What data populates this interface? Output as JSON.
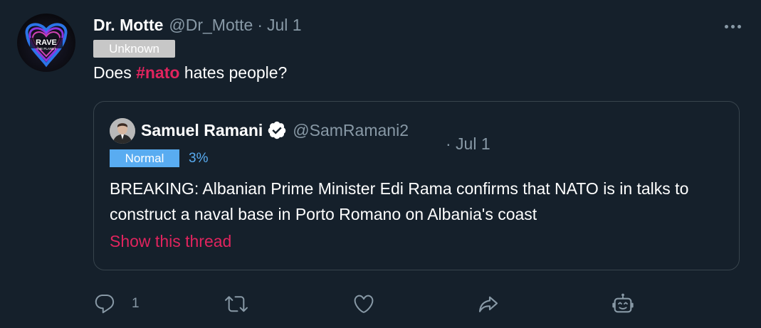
{
  "tweet": {
    "display_name": "Dr. Motte",
    "handle": "@Dr_Motte",
    "separator": "·",
    "date": "Jul 1",
    "label": "Unknown",
    "avatar_text_line1": "RAVE",
    "avatar_text_line2": "THE PLANET",
    "text_before": "Does ",
    "hashtag": "#nato",
    "text_after": " hates people?"
  },
  "quote": {
    "display_name": "Samuel Ramani",
    "handle": "@SamRamani2",
    "date": "· Jul 1",
    "label": "Normal",
    "score": "3%",
    "text": "BREAKING: Albanian Prime Minister Edi Rama confirms that NATO is in talks to construct a naval base in Porto Romano on Albania's coast",
    "show_thread": "Show this thread"
  },
  "actions": {
    "reply_count": "1"
  },
  "icons": {
    "more": "more-icon",
    "verified": "verified-badge-icon",
    "reply": "reply-icon",
    "retweet": "retweet-icon",
    "like": "heart-icon",
    "share": "share-icon",
    "bot": "robot-icon"
  },
  "colors": {
    "background": "#15202b",
    "secondary_text": "#8899a6",
    "hashtag": "#e0245e",
    "label_unknown": "#c7c7c7",
    "label_normal": "#59acf1",
    "border": "#38444d"
  }
}
